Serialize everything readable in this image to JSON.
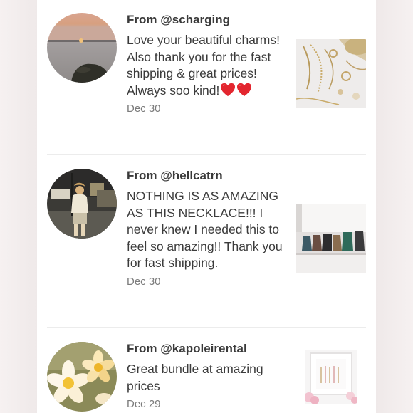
{
  "reviews": [
    {
      "from_prefix": "From ",
      "handle": "@scharging",
      "text": "Love your beautiful charms! Also thank you for the fast shipping & great prices! Always soo kind!",
      "emoji": "heart-icon x2",
      "date": "Dec 30"
    },
    {
      "from_prefix": "From ",
      "handle": "@hellcatrn",
      "text": "NOTHING IS AS AMAZING AS THIS NECKLACE!!! I never knew I needed this to feel so amazing!! Thank you for fast shipping.",
      "date": "Dec 30"
    },
    {
      "from_prefix": "From ",
      "handle": "@kapoleirental",
      "text": "Great bundle at amazing prices",
      "date": "Dec 29"
    }
  ],
  "colors": {
    "text": "#3b3b3b",
    "date": "#7b7b7b",
    "divider": "#ececec",
    "heart": "#e3262f"
  }
}
